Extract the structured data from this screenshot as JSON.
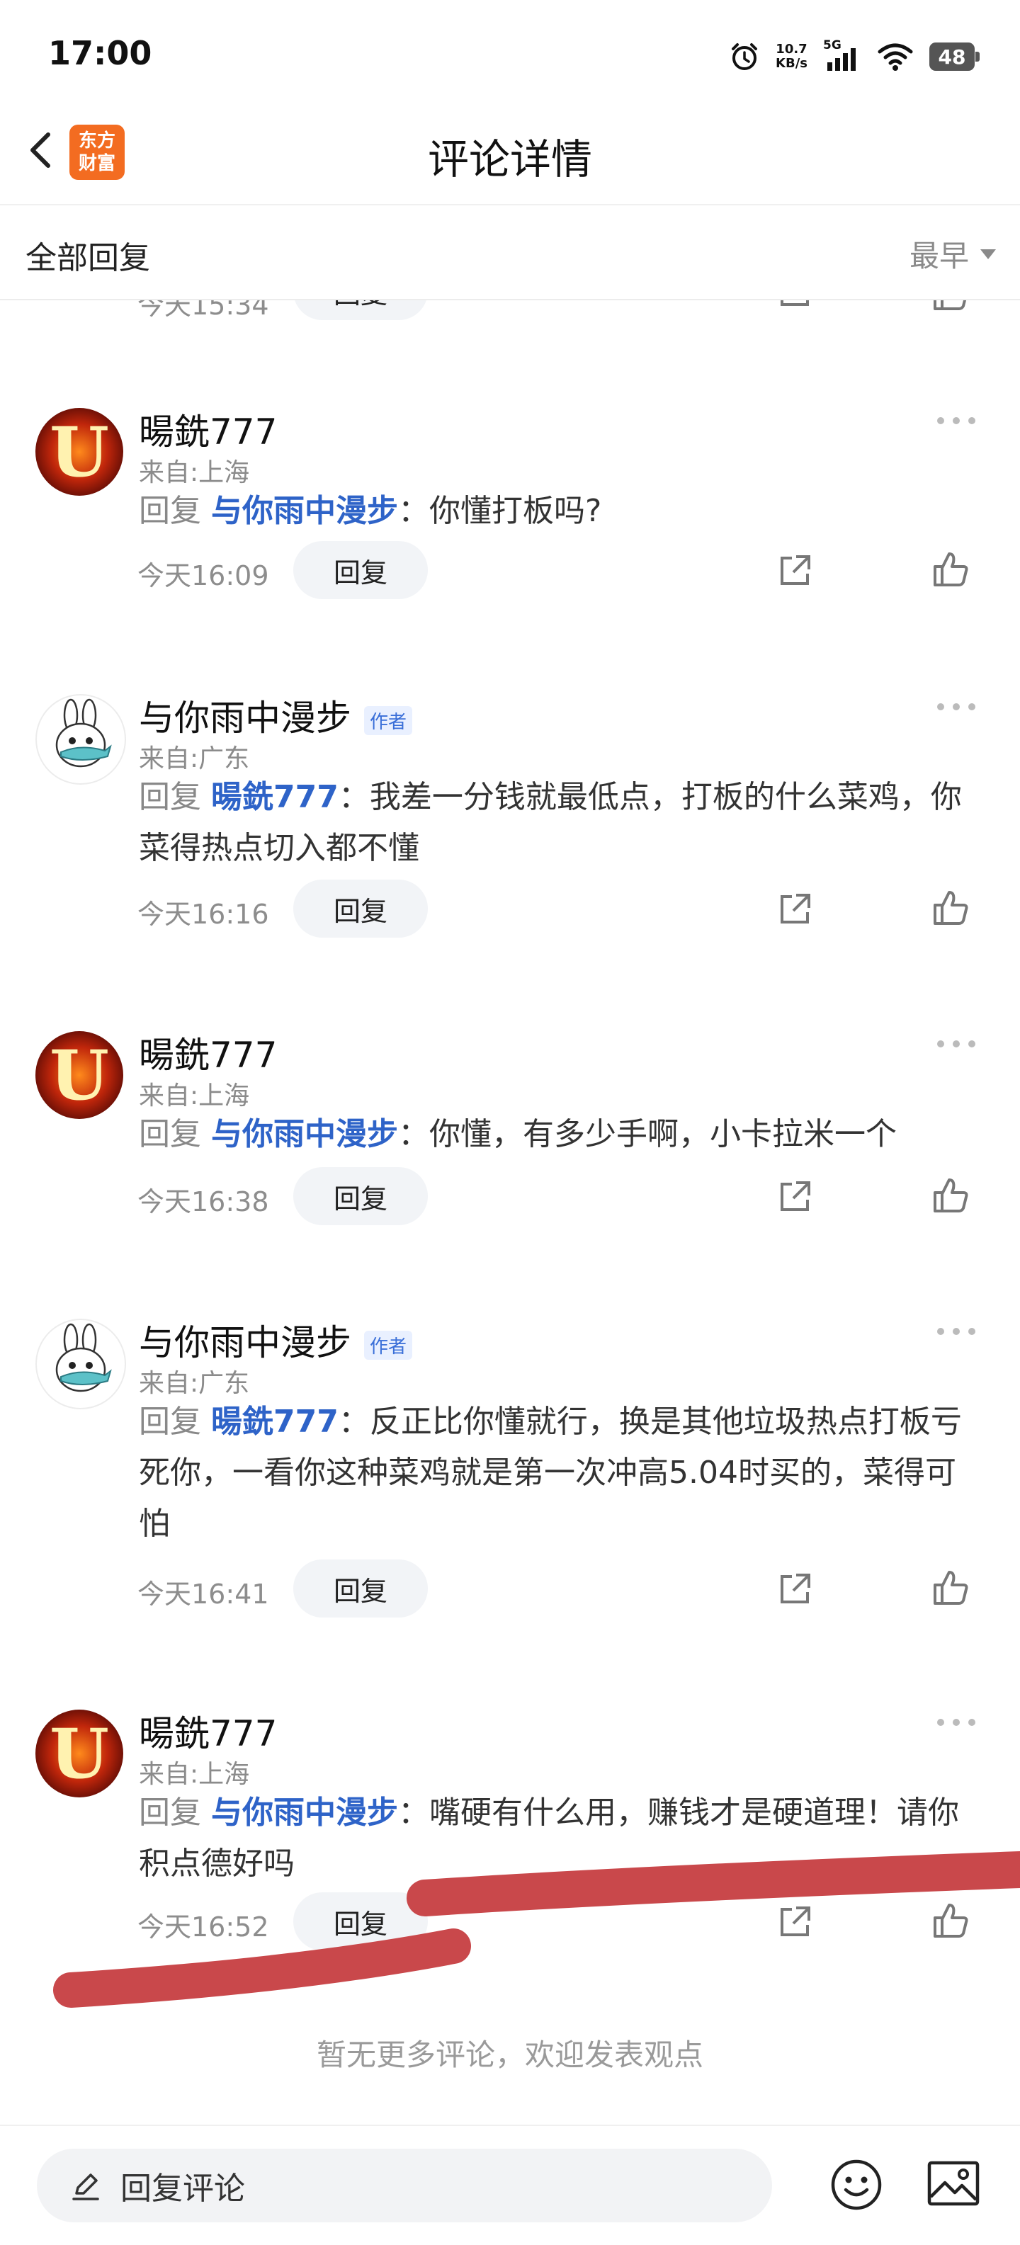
{
  "status_bar": {
    "time": "17:00",
    "net_speed_value": "10.7",
    "net_speed_unit": "KB/s",
    "network": "5G",
    "battery": "48",
    "icons": [
      "alarm-icon",
      "signal-icon",
      "wifi-icon",
      "battery-icon"
    ]
  },
  "nav": {
    "title": "评论详情",
    "logo_line1": "东方",
    "logo_line2": "财富",
    "back_icon": "back-arrow-icon"
  },
  "filter": {
    "title": "全部回复",
    "sort_value": "最早"
  },
  "cut_row": {
    "time": "今天15:34",
    "reply_label": "回复"
  },
  "comments": [
    {
      "user": "暘銑777",
      "avatar": "fire-u-avatar",
      "is_author": false,
      "location": "来自:上海",
      "reply_prefix": "回复",
      "mention": "与你雨中漫步",
      "colon": "：",
      "text": "你懂打板吗?",
      "time": "今天16:09",
      "reply_label": "回复"
    },
    {
      "user": "与你雨中漫步",
      "avatar": "bunny-avatar",
      "is_author": true,
      "author_badge": "作者",
      "location": "来自:广东",
      "reply_prefix": "回复",
      "mention": "暘銑777",
      "colon": "：",
      "text": "我差一分钱就最低点，打板的什么菜鸡，你菜得热点切入都不懂",
      "time": "今天16:16",
      "reply_label": "回复"
    },
    {
      "user": "暘銑777",
      "avatar": "fire-u-avatar",
      "is_author": false,
      "location": "来自:上海",
      "reply_prefix": "回复",
      "mention": "与你雨中漫步",
      "colon": "：",
      "text": "你懂，有多少手啊，小卡拉米一个",
      "time": "今天16:38",
      "reply_label": "回复"
    },
    {
      "user": "与你雨中漫步",
      "avatar": "bunny-avatar",
      "is_author": true,
      "author_badge": "作者",
      "location": "来自:广东",
      "reply_prefix": "回复",
      "mention": "暘銑777",
      "colon": "：",
      "text": "反正比你懂就行，换是其他垃圾热点打板亏死你，一看你这种菜鸡就是第一次冲高5.04时买的，菜得可怕",
      "time": "今天16:41",
      "reply_label": "回复"
    },
    {
      "user": "暘銑777",
      "avatar": "fire-u-avatar",
      "is_author": false,
      "location": "来自:上海",
      "reply_prefix": "回复",
      "mention": "与你雨中漫步",
      "colon": "：",
      "text": "嘴硬有什么用，赚钱才是硬道理！请你积点德好吗",
      "time": "今天16:52",
      "reply_label": "回复"
    }
  ],
  "footer_note": "暂无更多评论，欢迎发表观点",
  "bottom_bar": {
    "input_placeholder": "回复评论",
    "emoji_icon": "emoji-icon",
    "image_icon": "image-icon"
  },
  "colors": {
    "mention": "#2e63c8",
    "logo": "#f36c21",
    "strike": "#c9484b",
    "reply_button_bg": "#f2f4f7"
  }
}
